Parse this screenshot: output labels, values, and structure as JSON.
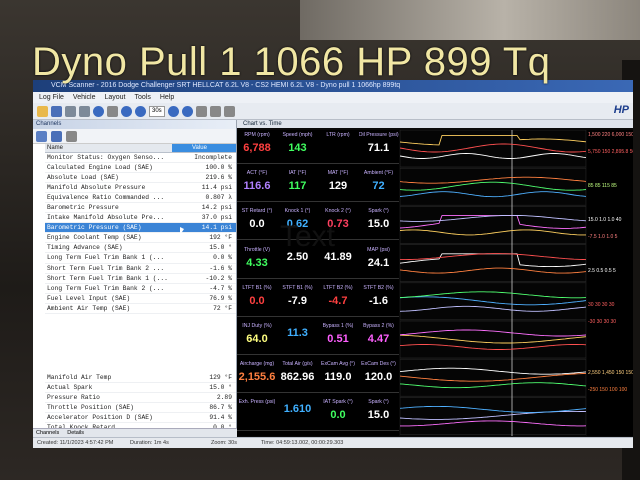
{
  "overlay_title": "Dyno Pull 1 1066 HP 899 Tq",
  "overlay_text": "Text",
  "window": {
    "title": "VCM Scanner - 2016 Dodge Challenger SRT HELLCAT 6.2L V8 - CS2 HEMI 6.2L V8 - Dyno pull 1 1066hp 899tq"
  },
  "menu": [
    "Log File",
    "Vehicle",
    "Layout",
    "Tools",
    "Help"
  ],
  "toolbar": {
    "zoom": "30s",
    "logo": "HP"
  },
  "channels": {
    "panel_title": "Channels",
    "col_name": "Name",
    "col_value": "Value",
    "rows": [
      {
        "name": "Monitor Status: Oxygen Senso...",
        "value": "Incomplete",
        "selected": false
      },
      {
        "name": "Calculated Engine Load (SAE)",
        "value": "100.0 %",
        "selected": false
      },
      {
        "name": "Absolute Load (SAE)",
        "value": "219.6 %",
        "selected": false
      },
      {
        "name": "Manifold Absolute Pressure",
        "value": "11.4 psi",
        "selected": false
      },
      {
        "name": "Equivalence Ratio Commanded ...",
        "value": "0.807 λ",
        "selected": false
      },
      {
        "name": "Barometric Pressure",
        "value": "14.2 psi",
        "selected": false
      },
      {
        "name": "Intake Manifold Absolute Pre...",
        "value": "37.0 psi",
        "selected": false
      },
      {
        "name": "Barometric Pressure (SAE)",
        "value": "14.1 psi",
        "selected": true
      },
      {
        "name": "Engine Coolant Temp (SAE)",
        "value": "192 °F",
        "selected": false
      },
      {
        "name": "Timing Advance (SAE)",
        "value": "15.0 °",
        "selected": false
      },
      {
        "name": "Long Term Fuel Trim Bank 1 (...",
        "value": "0.0 %",
        "selected": false
      },
      {
        "name": "Short Term Fuel Trim Bank 2 ...",
        "value": "-1.6 %",
        "selected": false
      },
      {
        "name": "Short Term Fuel Trim Bank 1 (...",
        "value": "-10.2 %",
        "selected": false
      },
      {
        "name": "Long Term Fuel Trim Bank 2 (...",
        "value": "-4.7 %",
        "selected": false
      },
      {
        "name": "Fuel Level Input (SAE)",
        "value": "76.9 %",
        "selected": false
      },
      {
        "name": "Ambient Air Temp (SAE)",
        "value": "72 °F",
        "selected": false
      }
    ],
    "rows2": [
      {
        "name": "Manifold Air Temp",
        "value": "129 °F"
      },
      {
        "name": "Actual Spark",
        "value": "15.0 °"
      },
      {
        "name": "Pressure Ratio",
        "value": "2.89"
      },
      {
        "name": "Throttle Position (SAE)",
        "value": "86.7 %"
      },
      {
        "name": "Accelerator Position D (SAE)",
        "value": "91.4 %"
      },
      {
        "name": "Total Knock Retard",
        "value": "0.0 °"
      }
    ],
    "tabs": [
      "Channels",
      "Details"
    ]
  },
  "chart_tab": "Chart vs. Time",
  "gauges": [
    [
      {
        "label": "RPM (rpm)",
        "value": "6,788",
        "color": "#ff4040"
      },
      {
        "label": "Speed (mph)",
        "value": "143",
        "color": "#40ff60"
      },
      {
        "label": "LTR (rpm)",
        "value": "",
        "color": "#ff8080"
      },
      {
        "label": "Oil Pressure (psi)",
        "value": "71.1",
        "color": "#ffffff"
      }
    ],
    [
      {
        "label": "ACT (°F)",
        "value": "116.6",
        "color": "#b080ff"
      },
      {
        "label": "IAT (°F)",
        "value": "117",
        "color": "#40ff60"
      },
      {
        "label": "MAT (°F)",
        "value": "129",
        "color": "#ffffff"
      },
      {
        "label": "Ambient (°F)",
        "value": "72",
        "color": "#40b0ff"
      }
    ],
    [
      {
        "label": "ST Retard (°)",
        "value": "0.0",
        "color": "#ffffff"
      },
      {
        "label": "Knock 1 (°)",
        "value": "0.62",
        "color": "#40b0ff"
      },
      {
        "label": "Knock 2 (°)",
        "value": "0.73",
        "color": "#ff4060"
      },
      {
        "label": "Spark (°)",
        "value": "15.0",
        "color": "#ffffff"
      }
    ],
    [
      {
        "label": "Throttle (V)",
        "value": "4.33",
        "color": "#40ff60"
      },
      {
        "label": "",
        "value": "2.50",
        "color": "#ffffff"
      },
      {
        "label": "",
        "value": "41.89",
        "color": "#ffffff"
      },
      {
        "label": "MAP (psi)",
        "value": "24.1",
        "color": "#ffffff"
      }
    ],
    [
      {
        "label": "LTFT B1 (%)",
        "value": "0.0",
        "color": "#ff4040"
      },
      {
        "label": "STFT B1 (%)",
        "value": "-7.9",
        "color": "#ffffff"
      },
      {
        "label": "LTFT B2 (%)",
        "value": "-4.7",
        "color": "#ff4040"
      },
      {
        "label": "STFT B2 (%)",
        "value": "-1.6",
        "color": "#ffffff"
      }
    ],
    [
      {
        "label": "INJ Duty (%)",
        "value": "64.0",
        "color": "#ffff80"
      },
      {
        "label": "",
        "value": "11.3",
        "color": "#40b0ff"
      },
      {
        "label": "Bypass 1 (%)",
        "value": "0.51",
        "color": "#ff60ff"
      },
      {
        "label": "Bypass 2 (%)",
        "value": "4.47",
        "color": "#ff60ff"
      }
    ],
    [
      {
        "label": "Aircharge (mg)",
        "value": "2,155.6",
        "color": "#ff8040"
      },
      {
        "label": "Total Air (g/s)",
        "value": "862.96",
        "color": "#ffffff"
      },
      {
        "label": "ExCam Avg (°)",
        "value": "119.0",
        "color": "#ffffff"
      },
      {
        "label": "ExCam Des (°)",
        "value": "120.0",
        "color": "#ffffff"
      }
    ],
    [
      {
        "label": "Exh. Press (psi)",
        "value": "",
        "color": "#ffffff"
      },
      {
        "label": "",
        "value": "1.610",
        "color": "#40b0ff"
      },
      {
        "label": "IAT Spark (°)",
        "value": "0.0",
        "color": "#40ff60"
      },
      {
        "label": "Spark (°)",
        "value": "15.0",
        "color": "#ffffff"
      }
    ]
  ],
  "legend": [
    {
      "text": "1,500  220  6,000  150",
      "color": "#ff8080"
    },
    {
      "text": "5,750  150  2,895.8  50",
      "color": "#ff6060"
    },
    {
      "text": "",
      "color": "#ffffff"
    },
    {
      "text": "85  85  115  85",
      "color": "#c0ff80"
    },
    {
      "text": "",
      "color": "#ffffff"
    },
    {
      "text": "15.0  1.0  1.0  40",
      "color": "#ffffff"
    },
    {
      "text": "-7.5  1.0  1.0  5",
      "color": "#ff8080"
    },
    {
      "text": "",
      "color": "#ffffff"
    },
    {
      "text": "2.5  0.5  0.5  5",
      "color": "#ffffff"
    },
    {
      "text": "",
      "color": "#ffffff"
    },
    {
      "text": "30  30  30  30",
      "color": "#ff6060"
    },
    {
      "text": "-30  30  30  30",
      "color": "#ff6060"
    },
    {
      "text": "",
      "color": "#ffffff"
    },
    {
      "text": "",
      "color": "#ffffff"
    },
    {
      "text": "2,550  1,450  150  150",
      "color": "#ffd080"
    },
    {
      "text": "-250  150  100  100",
      "color": "#ff8040"
    },
    {
      "text": "",
      "color": "#ffffff"
    },
    {
      "text": "",
      "color": "#ffffff"
    }
  ],
  "statusbar": {
    "created": "Created: 11/1/2023 4:57:42 PM",
    "duration": "Duration: 1m 4s",
    "zoom": "Zoom: 30s",
    "time": "Time: 04:59:13.002, 00:00:29.303"
  }
}
